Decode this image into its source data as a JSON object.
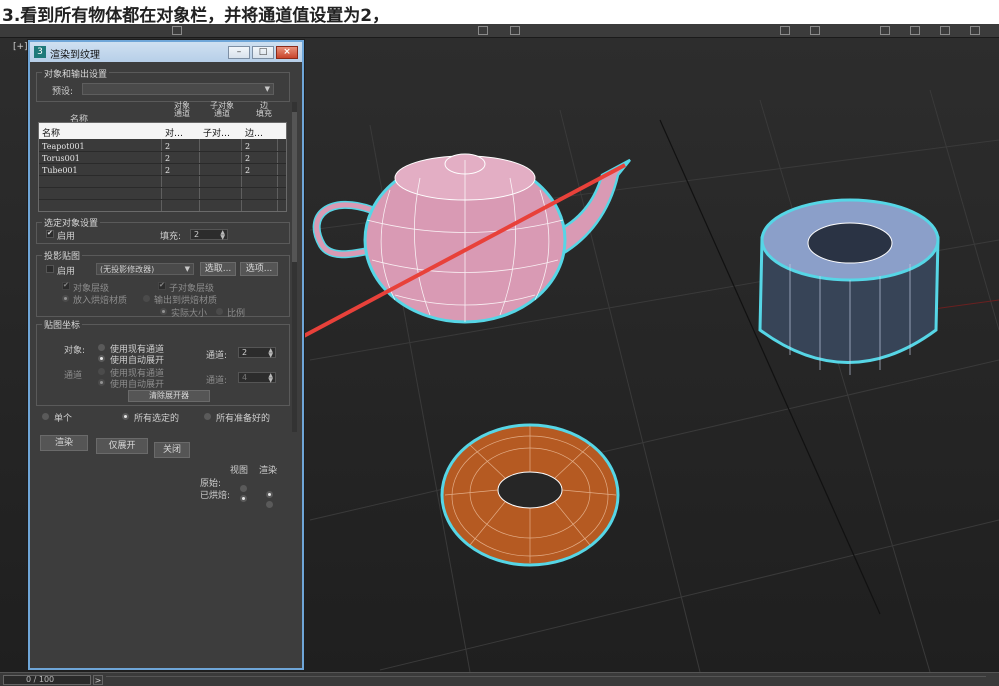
{
  "banner": "3.看到所有物体都在对象栏，并将通道值设置为2，",
  "viewport": {
    "label": "[+]"
  },
  "timeline": {
    "frame_text": "0 / 100",
    "next": ">"
  },
  "dialog": {
    "app_icon": "3",
    "title": "渲染到纹理",
    "window_buttons": {
      "minimize": "–",
      "maximize": "□",
      "close": "×"
    },
    "objects_output": {
      "group_title": "对象和输出设置",
      "preset_label": "预设:",
      "preset_value": ""
    },
    "table": {
      "upper_headers": {
        "name": "名称",
        "obj_channel": "对象\n通道",
        "sub_channel": "子对象\n通道",
        "edge_padding": "边\n填充"
      },
      "headers": [
        "名称",
        "对…",
        "子对…",
        "边…"
      ],
      "rows": [
        {
          "name": "Teapot001",
          "obj": "2",
          "sub": "",
          "pad": "2"
        },
        {
          "name": "Torus001",
          "obj": "2",
          "sub": "",
          "pad": "2"
        },
        {
          "name": "Tube001",
          "obj": "2",
          "sub": "",
          "pad": "2"
        }
      ]
    },
    "selected_settings": {
      "group_title": "选定对象设置",
      "enabled_label": "启用",
      "enabled": true,
      "padding_label": "填充:",
      "padding_value": "2"
    },
    "projection": {
      "group_title": "投影贴图",
      "enabled_label": "启用",
      "enabled": false,
      "modifier_value": "(无投影修改器)",
      "pick_button": "选取...",
      "options_button": "选项...",
      "object_level": "对象层级",
      "subobject_level": "子对象层级",
      "put_to_baked": "放入烘焙材质",
      "output_to_baked": "输出到烘焙材质",
      "proportional": "实际大小",
      "ratio": "比例"
    },
    "mapping": {
      "group_title": "贴图坐标",
      "object_label": "对象:",
      "use_existing": "使用现有通道",
      "use_auto": "使用自动展开",
      "channel_label": "通道:",
      "channel_value": "2",
      "sub_label": "通道",
      "sub_use_existing": "使用现有通道",
      "sub_use_auto": "使用自动展开",
      "sub_channel_label": "通道:",
      "sub_channel_value": "4",
      "clear_unwrap": "清除展开器"
    },
    "scope": {
      "single": "单个",
      "all_selected": "所有选定的",
      "all_prepared": "所有准备好的"
    },
    "actions": {
      "render": "渲染",
      "unwrap_only": "仅展开",
      "close": "关闭"
    },
    "footer": {
      "col_view": "视图",
      "col_render": "渲染",
      "original": "原始:",
      "baked": "已烘焙:"
    }
  },
  "colors": {
    "selection_outline": "#56d6e6",
    "annotation_arrow": "#e8413a",
    "teapot": "#d99ab4",
    "tube": "#8b9fc9",
    "torus": "#b55a22"
  }
}
